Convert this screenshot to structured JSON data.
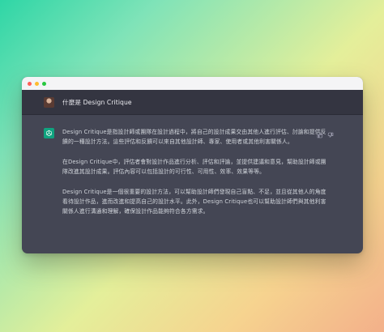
{
  "window": {
    "traffic_lights": [
      "#ff5f57",
      "#febc2e",
      "#28c840"
    ]
  },
  "conversation": {
    "user_question": "什麼是 Design Critique",
    "answer_paragraphs": [
      "Design Critique是指設計師或團隊在設計過程中，將自己的設計成果交由其他人進行評估、討論和提供反饋的一種設計方法。這些評估和反饋可以來自其他設計師、專家、使用者或其他利害關係人。",
      "在Design Critique中，評估者會對設計作品進行分析、評估和評論，並提供建議和意見，幫助設計師或團隊改進其設計成果。評估內容可以包括設計的可行性、可用性、效率、效果等等。",
      "Design Critique是一個很重要的設計方法，可以幫助設計師們發現自己盲點、不足，並且從其他人的角度看待設計作品，進而改進和提高自己的設計水平。此外，Design Critique也可以幫助設計師們與其他利害關係人進行溝通和理解，確保設計作品能夠符合各方需求。"
    ],
    "icons": {
      "user": "avatar",
      "assistant": "openai-logo-icon",
      "feedback": [
        "thumbs-up-icon",
        "thumbs-down-icon"
      ]
    },
    "colors": {
      "user_row_bg": "#343541",
      "answer_bg": "#444654",
      "assistant_icon_bg": "#10a37f"
    }
  }
}
